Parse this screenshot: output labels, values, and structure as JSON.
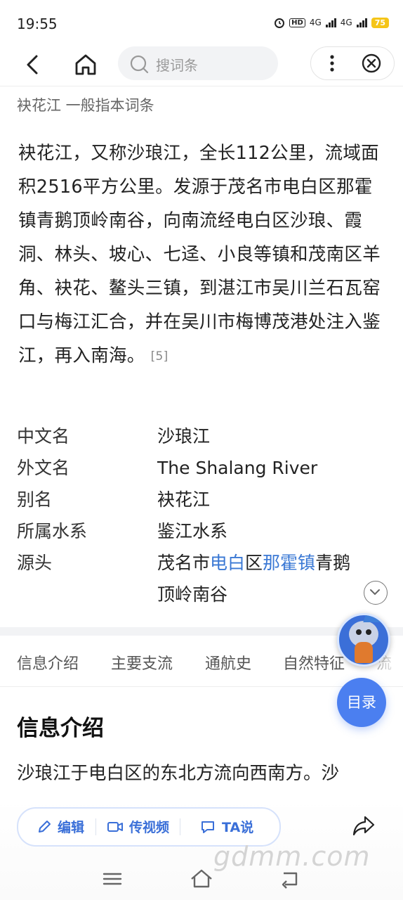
{
  "status_bar": {
    "time": "19:55",
    "hd_badge": "HD",
    "net1": "4G",
    "net2": "4G",
    "battery": "75"
  },
  "nav": {
    "search_placeholder": "搜词条"
  },
  "breadcrumb": "袂花江 一般指本词条",
  "intro": {
    "text": "袂花江，又称沙琅江，全长112公里，流域面积2516平方公里。发源于茂名市电白区那霍镇青鹅顶岭南谷，向南流经电白区沙琅、霞洞、林头、坡心、七迳、小良等镇和茂南区羊角、袂花、鳌头三镇，到湛江市吴川兰石瓦窑口与梅江汇合，并在吴川市梅博茂港处注入鉴江，再入南海。",
    "citation": "[5]"
  },
  "infobox": {
    "rows": [
      {
        "key": "中文名",
        "value": "沙琅江"
      },
      {
        "key": "外文名",
        "value": "The Shalang River"
      },
      {
        "key": "别名",
        "value": "袂花江"
      },
      {
        "key": "所属水系",
        "value": "鉴江水系"
      }
    ],
    "source": {
      "key": "源头",
      "part1": "茂名市",
      "link1": "电白",
      "part2": "区",
      "link2": "那霍镇",
      "part3": "青鹅顶岭南谷"
    }
  },
  "tabs": [
    "信息介绍",
    "主要支流",
    "通航史",
    "自然特征",
    "流"
  ],
  "section": {
    "title": "信息介绍",
    "text_line1": "沙琅江于电白区的东北方流向西南方。沙"
  },
  "floating": {
    "toc_label": "目录"
  },
  "actions": {
    "edit": "编辑",
    "video": "传视频",
    "ta": "TA说"
  },
  "watermark": "gdmm.com",
  "colors": {
    "accent": "#4b7ff0",
    "link": "#3a78d4",
    "action_text": "#3a6fd8",
    "battery": "#f5c518"
  }
}
